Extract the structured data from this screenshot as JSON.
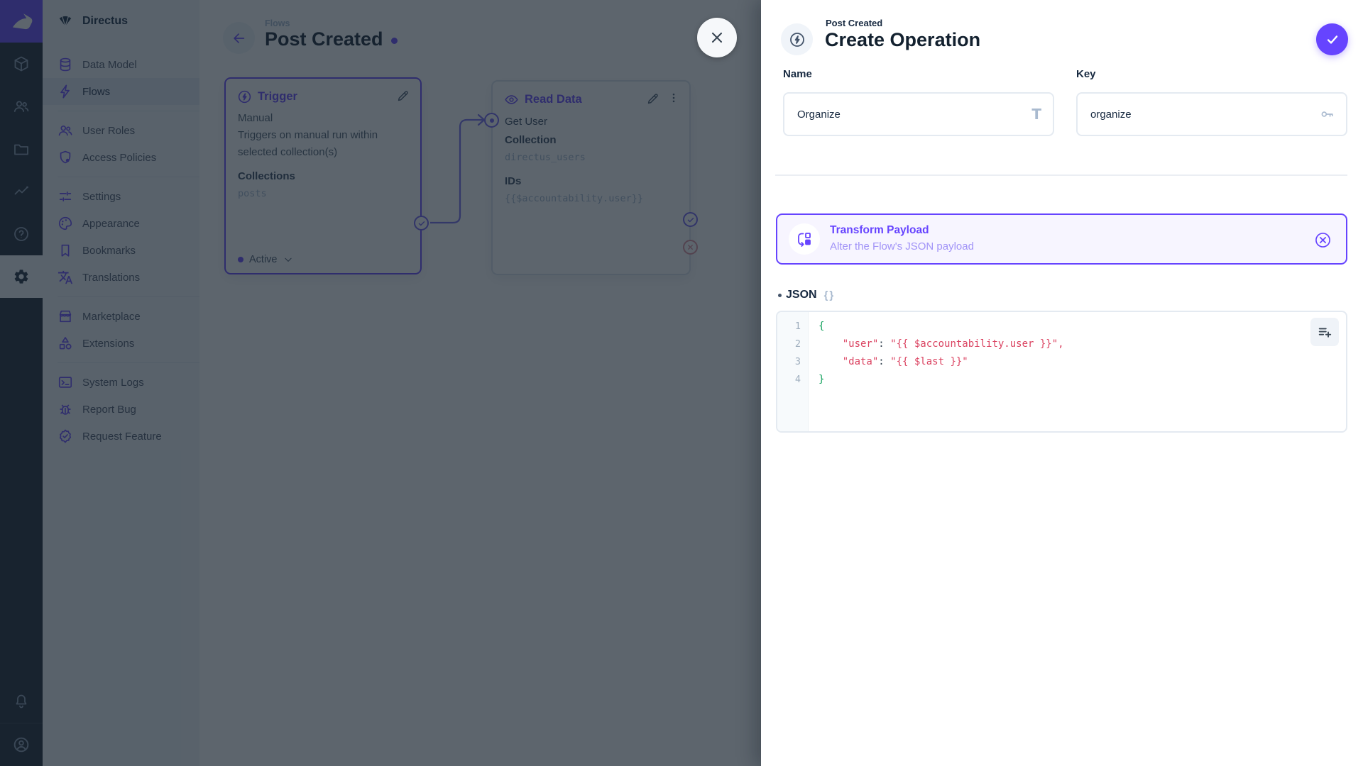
{
  "colors": {
    "accent": "#6644FF",
    "module_bar_bg": "#18222F",
    "nav_bg": "#F0F4F9",
    "heading": "#13212F",
    "muted_mono": "#A2B5CD",
    "overlay": "rgba(24,36,47,0.70)",
    "code_green": "#14A25E",
    "code_red": "#DB4462",
    "reject_red": "#DC8C9B"
  },
  "module_bar": {
    "icons": [
      "directus-rabbit-logo",
      "content-cube-icon",
      "users-icon",
      "files-folder-icon",
      "insights-chart-icon",
      "help-icon",
      "settings-gear-icon"
    ],
    "active_module": "settings",
    "bottom_icons": [
      "notifications-bell-icon",
      "user-avatar-icon"
    ]
  },
  "nav": {
    "project_name": "Directus",
    "active_item": "Flows",
    "items": [
      {
        "label": "Data Model",
        "icon": "database-icon"
      },
      {
        "label": "Flows",
        "icon": "bolt-icon"
      },
      {
        "label": "User Roles",
        "icon": "people-icon"
      },
      {
        "label": "Access Policies",
        "icon": "shield-icon"
      },
      {
        "label": "Settings",
        "icon": "tune-icon"
      },
      {
        "label": "Appearance",
        "icon": "palette-icon"
      },
      {
        "label": "Bookmarks",
        "icon": "bookmark-icon"
      },
      {
        "label": "Translations",
        "icon": "translate-icon"
      },
      {
        "label": "Marketplace",
        "icon": "storefront-icon"
      },
      {
        "label": "Extensions",
        "icon": "shapes-icon"
      },
      {
        "label": "System Logs",
        "icon": "terminal-icon"
      },
      {
        "label": "Report Bug",
        "icon": "bug-icon"
      },
      {
        "label": "Request Feature",
        "icon": "feature-seal-icon"
      }
    ]
  },
  "flow_page": {
    "breadcrumb": "Flows",
    "title": "Post Created",
    "trigger_card": {
      "title": "Trigger",
      "type": "Manual",
      "description": "Triggers on manual run within selected collection(s)",
      "field_label": "Collections",
      "field_value": "posts",
      "status_label": "Active"
    },
    "read_card": {
      "title": "Read Data",
      "operation_name": "Get User",
      "field1_label": "Collection",
      "field1_value": "directus_users",
      "field2_label": "IDs",
      "field2_value": "{{$accountability.user}}"
    }
  },
  "drawer": {
    "breadcrumb": "Post Created",
    "title": "Create Operation",
    "name_label": "Name",
    "name_value": "Organize",
    "key_label": "Key",
    "key_value": "organize",
    "operation": {
      "title": "Transform Payload",
      "subtitle": "Alter the Flow's JSON payload"
    },
    "json_label": "JSON",
    "braces_glyph": "{}",
    "code": {
      "line_numbers": [
        "1",
        "2",
        "3",
        "4"
      ],
      "lines": [
        {
          "tokens": [
            {
              "t": "{",
              "c": "brace"
            }
          ]
        },
        {
          "tokens": [
            {
              "t": "    ",
              "c": "plain"
            },
            {
              "t": "\"user\"",
              "c": "str"
            },
            {
              "t": ": ",
              "c": "pun"
            },
            {
              "t": "\"{{ $accountability.user }}\"",
              "c": "str"
            },
            {
              "t": ",",
              "c": "red"
            }
          ]
        },
        {
          "tokens": [
            {
              "t": "    ",
              "c": "plain"
            },
            {
              "t": "\"data\"",
              "c": "str"
            },
            {
              "t": ": ",
              "c": "pun"
            },
            {
              "t": "\"{{ $last }}\"",
              "c": "str"
            }
          ]
        },
        {
          "tokens": [
            {
              "t": "}",
              "c": "brace"
            }
          ]
        }
      ]
    }
  }
}
